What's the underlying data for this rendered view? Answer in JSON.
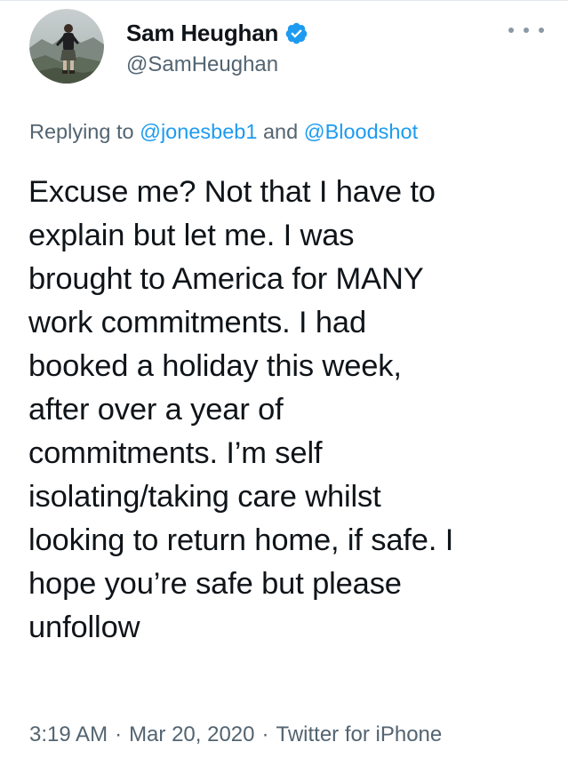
{
  "author": {
    "display_name": "Sam Heughan",
    "handle": "@SamHeughan",
    "verified": true,
    "avatar_icon": "profile-photo-man-in-kilt"
  },
  "more_icon": "ellipsis-icon",
  "reply": {
    "prefix": "Replying to ",
    "mention_1": "@jonesbeb1",
    "joiner": " and ",
    "mention_2": "@Bloodshot"
  },
  "tweet": {
    "lines": [
      "Excuse me? Not that I have to",
      "explain but let me. I was",
      "brought to America for MANY",
      "work commitments. I had",
      "booked a holiday this week,",
      "after over a year of",
      "commitments. I’m self",
      "isolating/taking care whilst",
      "looking to return home, if safe. I",
      "hope you’re safe but please",
      "unfollow"
    ]
  },
  "meta": {
    "time": "3:19 AM",
    "separator": "·",
    "date": "Mar 20, 2020",
    "source": "Twitter for iPhone"
  },
  "colors": {
    "link": "#1d9bf0",
    "secondary_text": "#536471",
    "primary_text": "#0f1419",
    "verified": "#1d9bf0"
  }
}
